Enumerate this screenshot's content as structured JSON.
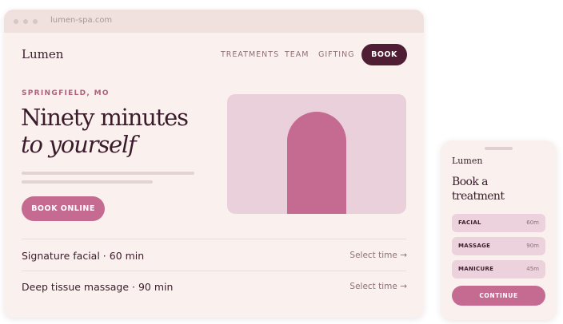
{
  "browser": {
    "url": "lumen-spa.com"
  },
  "site": {
    "logo": "Lumen",
    "nav": [
      "TREATMENTS",
      "TEAM",
      "GIFTING"
    ],
    "book_label": "BOOK",
    "eyebrow": "SPRINGFIELD, MO",
    "headline_line1": "Ninety minutes",
    "headline_line2": "to yourself",
    "cta_label": "BOOK ONLINE",
    "services": [
      {
        "name": "Signature facial · 60 min",
        "action": "Select time →"
      },
      {
        "name": "Deep tissue massage · 90 min",
        "action": "Select time →"
      }
    ]
  },
  "phone": {
    "logo": "Lumen",
    "title_line1": "Book a",
    "title_line2": "treatment",
    "options": [
      {
        "name": "FACIAL",
        "duration": "60m"
      },
      {
        "name": "MASSAGE",
        "duration": "90m"
      },
      {
        "name": "MANICURE",
        "duration": "45m"
      }
    ],
    "continue_label": "CONTINUE"
  },
  "colors": {
    "accent": "#c56b91",
    "dark": "#4f1d34",
    "background": "#faf1ef"
  }
}
